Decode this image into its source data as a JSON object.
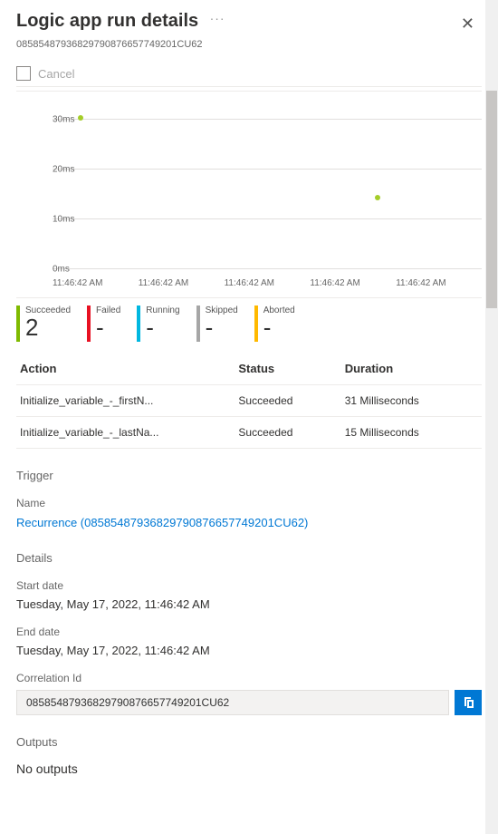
{
  "header": {
    "title": "Logic app run details",
    "run_id": "08585487936829790876657749201CU62",
    "cancel_label": "Cancel"
  },
  "chart_data": {
    "type": "scatter",
    "title": "",
    "xlabel": "",
    "ylabel": "",
    "y_ticks": [
      "0ms",
      "10ms",
      "20ms",
      "30ms"
    ],
    "ylim": [
      0,
      30
    ],
    "x_ticks": [
      "11:46:42 AM",
      "11:46:42 AM",
      "11:46:42 AM",
      "11:46:42 AM",
      "11:46:42 AM"
    ],
    "series": [
      {
        "name": "duration",
        "points": [
          {
            "x_index": 0,
            "y": 31
          },
          {
            "x_index": 3,
            "y": 15
          }
        ]
      }
    ]
  },
  "status_summary": [
    {
      "label": "Succeeded",
      "value": "2",
      "color": "#7fba00"
    },
    {
      "label": "Failed",
      "value": "-",
      "color": "#e81123"
    },
    {
      "label": "Running",
      "value": "-",
      "color": "#00b7e0"
    },
    {
      "label": "Skipped",
      "value": "-",
      "color": "#a6a6a6"
    },
    {
      "label": "Aborted",
      "value": "-",
      "color": "#ffb900"
    }
  ],
  "actions_table": {
    "columns": [
      "Action",
      "Status",
      "Duration"
    ],
    "rows": [
      {
        "action": "Initialize_variable_-_firstN...",
        "status": "Succeeded",
        "duration": "31 Milliseconds"
      },
      {
        "action": "Initialize_variable_-_lastNa...",
        "status": "Succeeded",
        "duration": "15 Milliseconds"
      }
    ]
  },
  "trigger": {
    "section": "Trigger",
    "name_label": "Name",
    "name_link": "Recurrence (08585487936829790876657749201CU62)"
  },
  "details": {
    "section": "Details",
    "start_label": "Start date",
    "start_value": "Tuesday, May 17, 2022, 11:46:42 AM",
    "end_label": "End date",
    "end_value": "Tuesday, May 17, 2022, 11:46:42 AM",
    "corr_label": "Correlation Id",
    "corr_value": "08585487936829790876657749201CU62"
  },
  "outputs": {
    "section": "Outputs",
    "value": "No outputs"
  }
}
